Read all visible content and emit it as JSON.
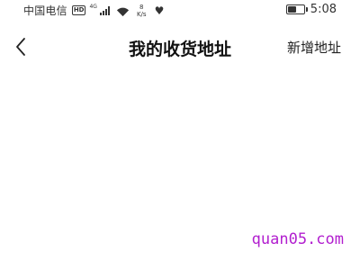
{
  "status_bar": {
    "carrier": "中国电信",
    "hd_badge": "HD",
    "network_type": "4G",
    "net_speed_value": "8",
    "net_speed_unit": "K/s",
    "time": "5:08",
    "battery_level": 0.55,
    "icons": [
      "hd-icon",
      "signal-icon",
      "wifi-icon",
      "heart-icon",
      "battery-icon"
    ]
  },
  "nav": {
    "back_icon": "chevron-left-icon",
    "title": "我的收货地址",
    "action_label": "新增地址"
  },
  "watermark": "quan05.com",
  "colors": {
    "background": "#ffffff",
    "title": "#111111",
    "watermark": "#b21fcf"
  }
}
